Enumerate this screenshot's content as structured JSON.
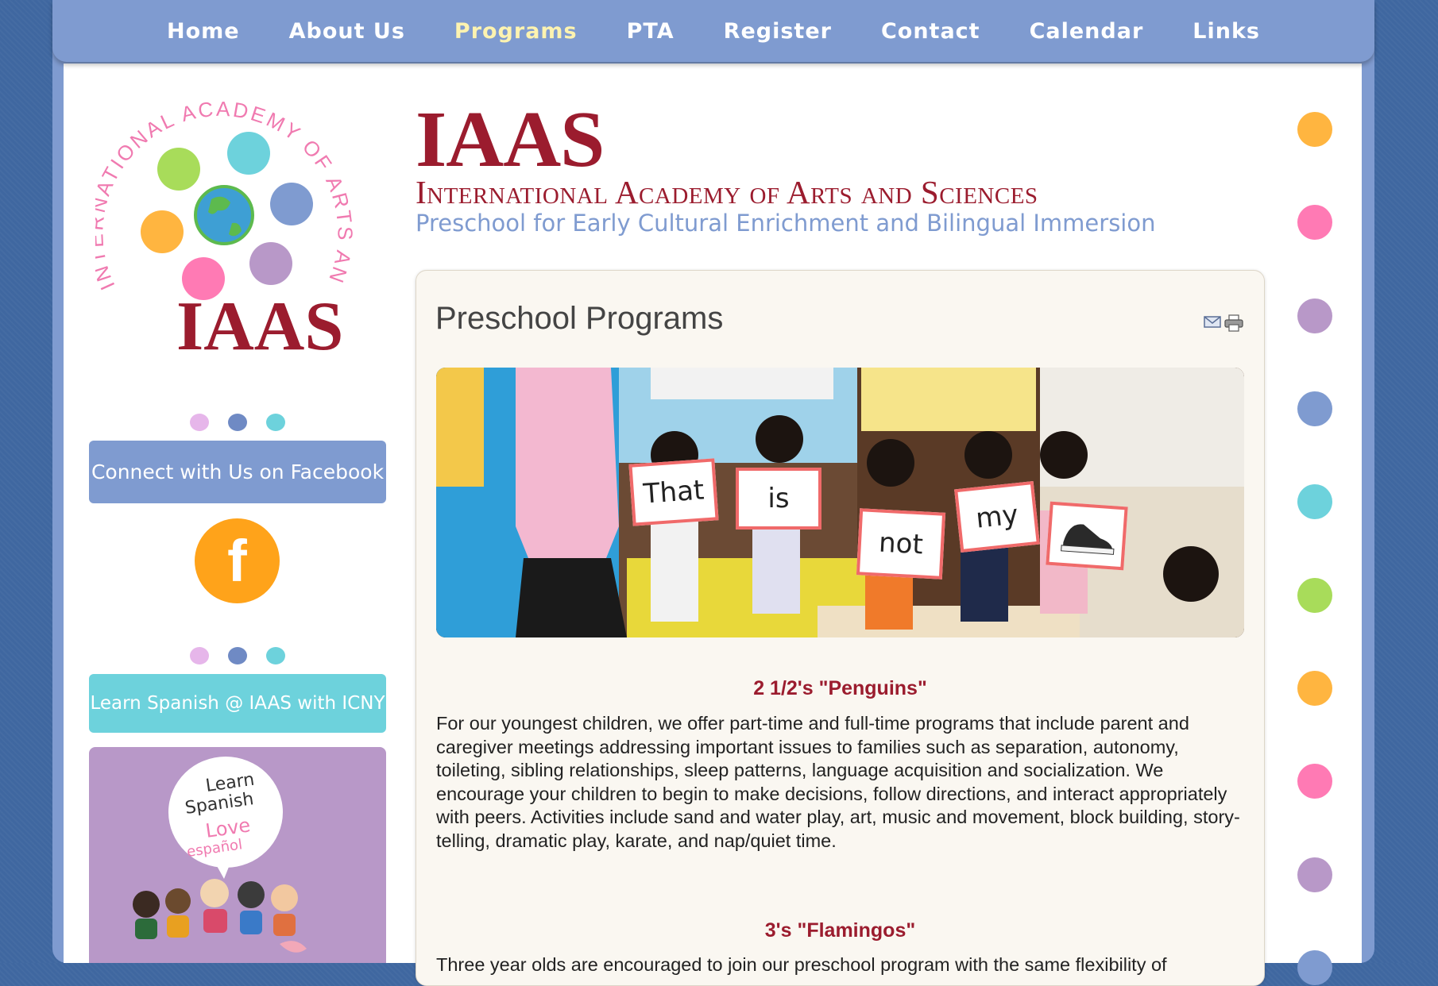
{
  "nav": {
    "items": [
      {
        "label": "Home",
        "active": false
      },
      {
        "label": "About Us",
        "active": false
      },
      {
        "label": "Programs",
        "active": true
      },
      {
        "label": "PTA",
        "active": false
      },
      {
        "label": "Register",
        "active": false
      },
      {
        "label": "Contact",
        "active": false
      },
      {
        "label": "Calendar",
        "active": false
      },
      {
        "label": "Links",
        "active": false
      }
    ]
  },
  "logo": {
    "arc_text": "INTERNATIONAL ACADEMY OF ARTS AND SCIENCES",
    "wordmark": "IAAS"
  },
  "header": {
    "title": "IAAS",
    "name": "International Academy of Arts and Sciences",
    "tagline": "Preschool for Early Cultural Enrichment and Bilingual Immersion"
  },
  "sidebar": {
    "facebook_button": "Connect with Us on Facebook",
    "facebook_icon": "f",
    "spanish_button": "Learn Spanish @ IAAS with ICNY",
    "spanish_card": {
      "line1": "Learn",
      "line2": "Spanish",
      "line3": "Love",
      "line4": "español"
    }
  },
  "content": {
    "page_title": "Preschool Programs",
    "photo_cards": [
      "That",
      "is",
      "not",
      "my"
    ],
    "sections": [
      {
        "heading": "2 1/2's \"Penguins\"",
        "text": "For our youngest children, we offer part-time and full-time programs that include parent and caregiver meetings addressing important issues to families such as separation, autonomy, toileting, sibling relationships, sleep patterns, language acquisition and socialization. We encourage your children to begin to make decisions, follow directions, and interact appropriately with peers. Activities include sand and water play, art, music and movement, block building, story-telling, dramatic play, karate, and nap/quiet time."
      },
      {
        "heading": "3's \"Flamingos\"",
        "text": "Three year olds are encouraged to join our preschool program with the same flexibility of"
      }
    ]
  },
  "colors": {
    "background": "#3f67a0",
    "frame": "#7f9bd0",
    "brand_red": "#9b1c2e",
    "orange": "#ffb540",
    "pink": "#ff7ab4",
    "purple": "#b898c8",
    "blue": "#7f9bd0",
    "cyan": "#6dd2dc",
    "green": "#a8dc5a"
  },
  "icons": {
    "email": "email-icon",
    "print": "print-icon",
    "facebook": "facebook-icon"
  }
}
